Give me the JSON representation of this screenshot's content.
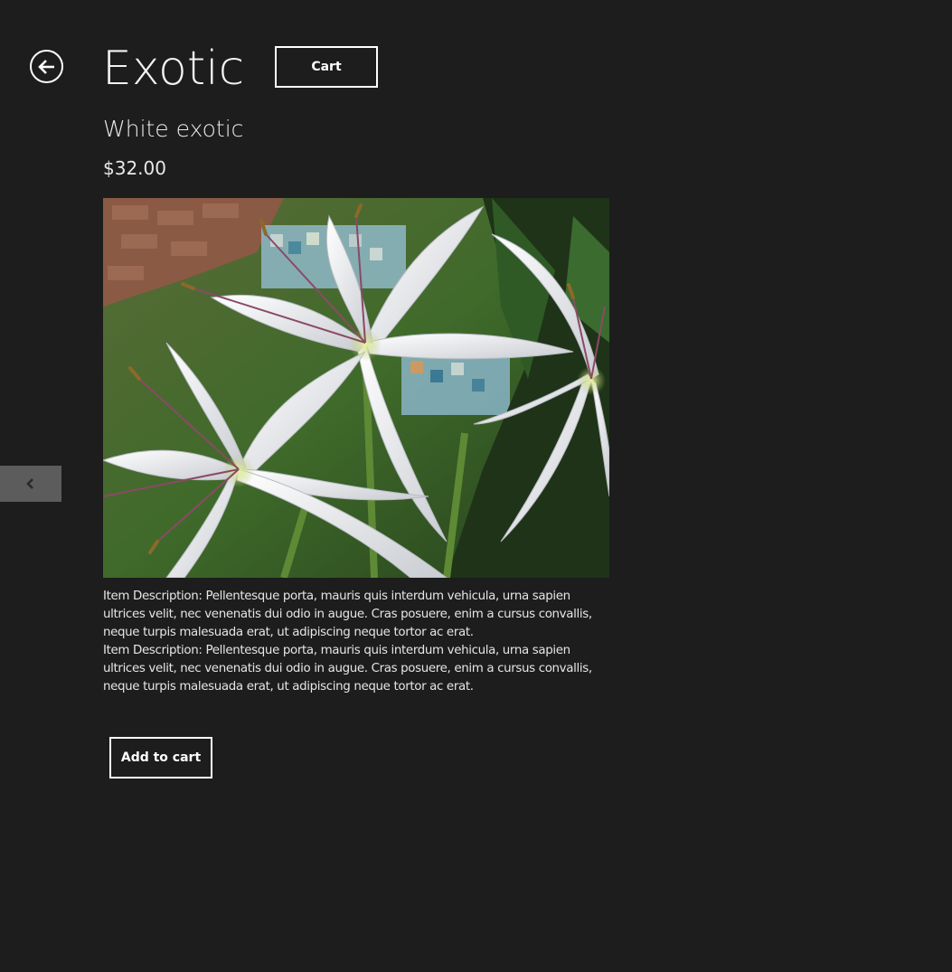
{
  "header": {
    "title": "Exotic",
    "back_icon": "back-arrow-circle-icon",
    "cart_label": "Cart"
  },
  "product": {
    "name": "White exotic",
    "price": "$32.00",
    "image": "white-spider-lily-photo",
    "description": [
      "Item Description: Pellentesque porta, mauris quis interdum vehicula, urna sapien ultrices velit, nec venenatis dui odio in augue. Cras posuere, enim a cursus convallis, neque turpis malesuada erat, ut adipiscing neque tortor ac erat.",
      "Item Description: Pellentesque porta, mauris quis interdum vehicula, urna sapien ultrices velit, nec venenatis dui odio in augue. Cras posuere, enim a cursus convallis, neque turpis malesuada erat, ut adipiscing neque tortor ac erat."
    ],
    "add_to_cart_label": "Add to cart"
  },
  "flipper": {
    "prev_icon": "chevron-left-icon"
  },
  "colors": {
    "background": "#1d1d1d",
    "foreground": "#ffffff",
    "flipper": "#5c5c5c"
  }
}
